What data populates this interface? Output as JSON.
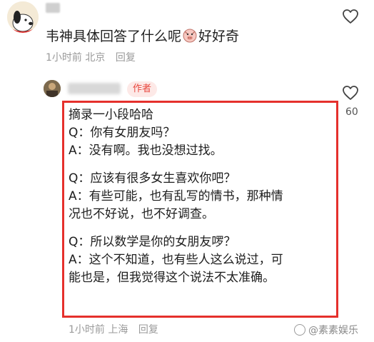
{
  "comment": {
    "text_before": "韦神具体回答了什么呢",
    "text_after": "好好奇",
    "emoji_icon": "pig-face-icon",
    "time": "1小时前",
    "location": "北京",
    "reply_label": "回复"
  },
  "author_reply": {
    "badge": "作者",
    "likes": "60",
    "lines": [
      "摘录一小段哈哈",
      "Q：你有女朋友吗？",
      "A：没有啊。我也没想过找。",
      "",
      "Q：应该有很多女生喜欢你吧？",
      "A：有些可能，也有乱写的情书，那种情",
      "况也不好说，也不好调查。",
      "",
      "Q：所以数学是你的女朋友啰？",
      "A：这个不知道，也有些人这么说过，可",
      "能也是，但我觉得这个说法不太准确。"
    ],
    "time": "1小时前",
    "location": "上海",
    "reply_label": "回复"
  },
  "watermark": "@素素娱乐",
  "colors": {
    "highlight_border": "#e5302c",
    "author_badge_bg": "#fde9e7",
    "author_badge_text": "#e8473e",
    "meta_text": "#9a9a9a"
  }
}
